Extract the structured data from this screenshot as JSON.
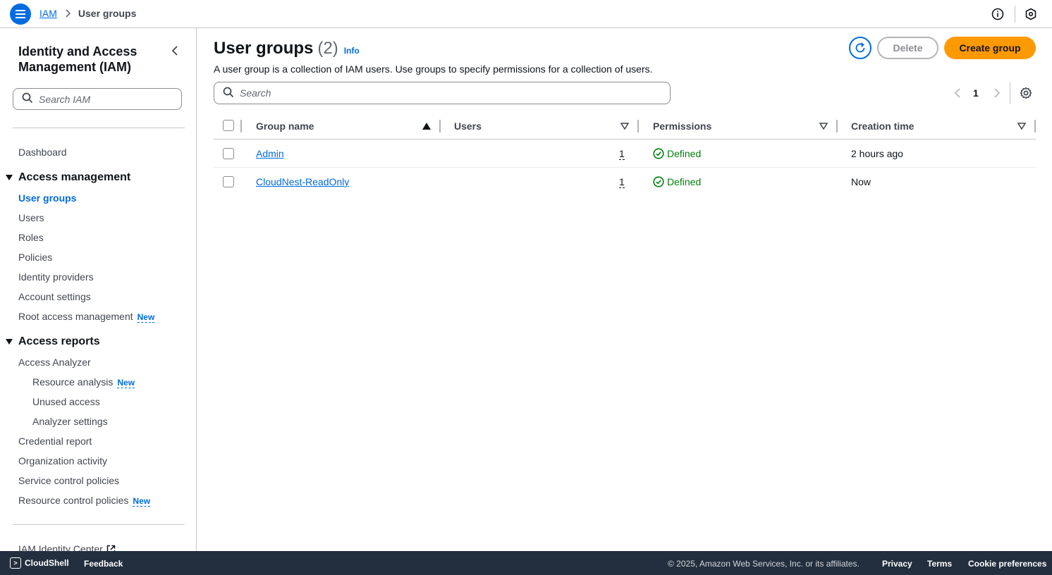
{
  "breadcrumb": {
    "root": "IAM",
    "current": "User groups"
  },
  "sidebar": {
    "title": "Identity and Access Management (IAM)",
    "search_placeholder": "Search IAM",
    "dashboard": "Dashboard",
    "access_management": {
      "heading": "Access management",
      "items": [
        {
          "label": "User groups",
          "active": true
        },
        {
          "label": "Users"
        },
        {
          "label": "Roles"
        },
        {
          "label": "Policies"
        },
        {
          "label": "Identity providers"
        },
        {
          "label": "Account settings"
        },
        {
          "label": "Root access management",
          "badge": "New"
        }
      ]
    },
    "access_reports": {
      "heading": "Access reports",
      "items": [
        {
          "label": "Access Analyzer"
        },
        {
          "label": "Resource analysis",
          "badge": "New",
          "sub": true
        },
        {
          "label": "Unused access",
          "sub": true
        },
        {
          "label": "Analyzer settings",
          "sub": true
        },
        {
          "label": "Credential report"
        },
        {
          "label": "Organization activity"
        },
        {
          "label": "Service control policies"
        },
        {
          "label": "Resource control policies",
          "badge": "New"
        }
      ]
    },
    "identity_center": "IAM Identity Center"
  },
  "main": {
    "title": "User groups",
    "count": "(2)",
    "info": "Info",
    "description": "A user group is a collection of IAM users. Use groups to specify permissions for a collection of users.",
    "buttons": {
      "delete": "Delete",
      "create": "Create group"
    },
    "search_placeholder": "Search",
    "pagination": {
      "current_page": "1"
    },
    "table": {
      "columns": [
        "Group name",
        "Users",
        "Permissions",
        "Creation time"
      ],
      "rows": [
        {
          "name": "Admin",
          "users": "1",
          "permissions": "Defined",
          "created": "2 hours ago"
        },
        {
          "name": "CloudNest-ReadOnly",
          "users": "1",
          "permissions": "Defined",
          "created": "Now"
        }
      ]
    }
  },
  "footer": {
    "cloudshell": "CloudShell",
    "feedback": "Feedback",
    "copyright": "© 2025, Amazon Web Services, Inc. or its affiliates.",
    "privacy": "Privacy",
    "terms": "Terms",
    "cookies": "Cookie preferences"
  },
  "colors": {
    "accent": "#006ce0",
    "primary_button": "#ff9900",
    "success": "#037f0c",
    "footer_bg": "#232f3e"
  }
}
